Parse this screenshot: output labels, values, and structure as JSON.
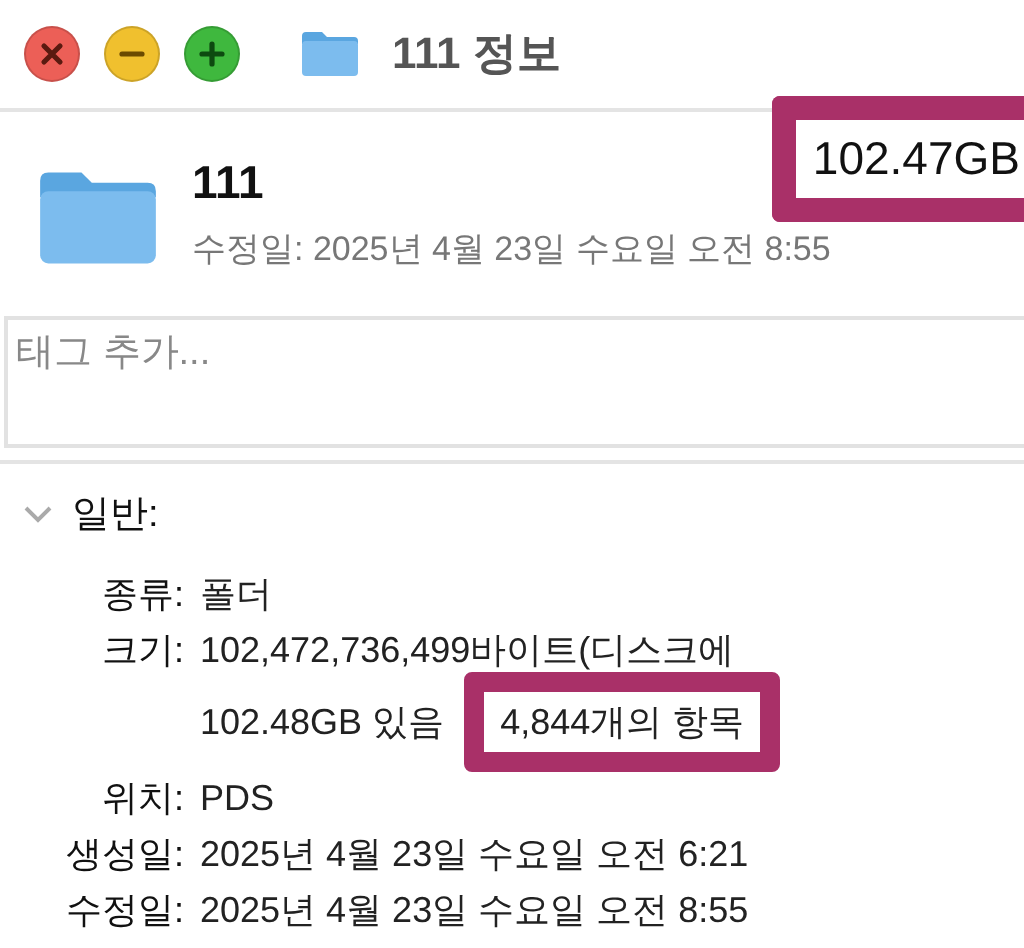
{
  "window": {
    "title": "111 정보"
  },
  "header": {
    "name": "111",
    "modified": "수정일: 2025년 4월 23일 수요일 오전 8:55",
    "size": "102.47GB",
    "size_highlighted": true
  },
  "tags": {
    "placeholder": "태그 추가..."
  },
  "general": {
    "title": "일반:",
    "expanded": true,
    "rows": [
      {
        "label": "종류:",
        "lines": [
          "폴더"
        ]
      },
      {
        "label": "크기:",
        "lines": [
          "102,472,736,499바이트(디스크에",
          "102.48GB 있음"
        ],
        "extra": {
          "text": "4,844개의 항목",
          "highlighted": true
        }
      },
      {
        "label": "위치:",
        "lines": [
          "PDS"
        ]
      },
      {
        "label": "생성일:",
        "lines": [
          "2025년 4월 23일 수요일 오전 6:21"
        ]
      },
      {
        "label": "수정일:",
        "lines": [
          "2025년 4월 23일 수요일 오전 8:55"
        ]
      }
    ]
  }
}
